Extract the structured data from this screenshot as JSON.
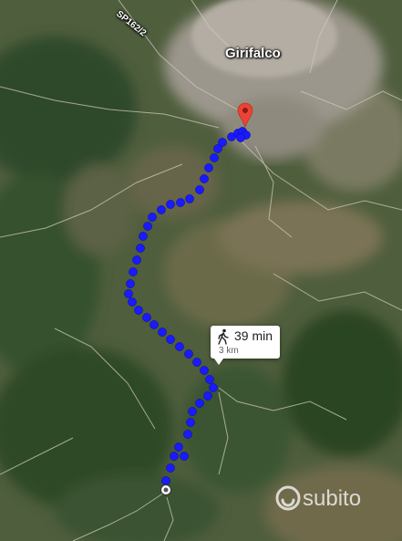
{
  "map": {
    "town_label": "Girifalco",
    "road_label": "SP162/2",
    "route_color": "#1a1aff",
    "pin_color": "#ea4335",
    "destination_icon": "map-pin-icon",
    "origin_icon": "start-circle-icon"
  },
  "route_info": {
    "mode_icon": "walking-person-icon",
    "duration": "39 min",
    "distance": "3 km"
  },
  "watermark": {
    "text": "subito"
  }
}
